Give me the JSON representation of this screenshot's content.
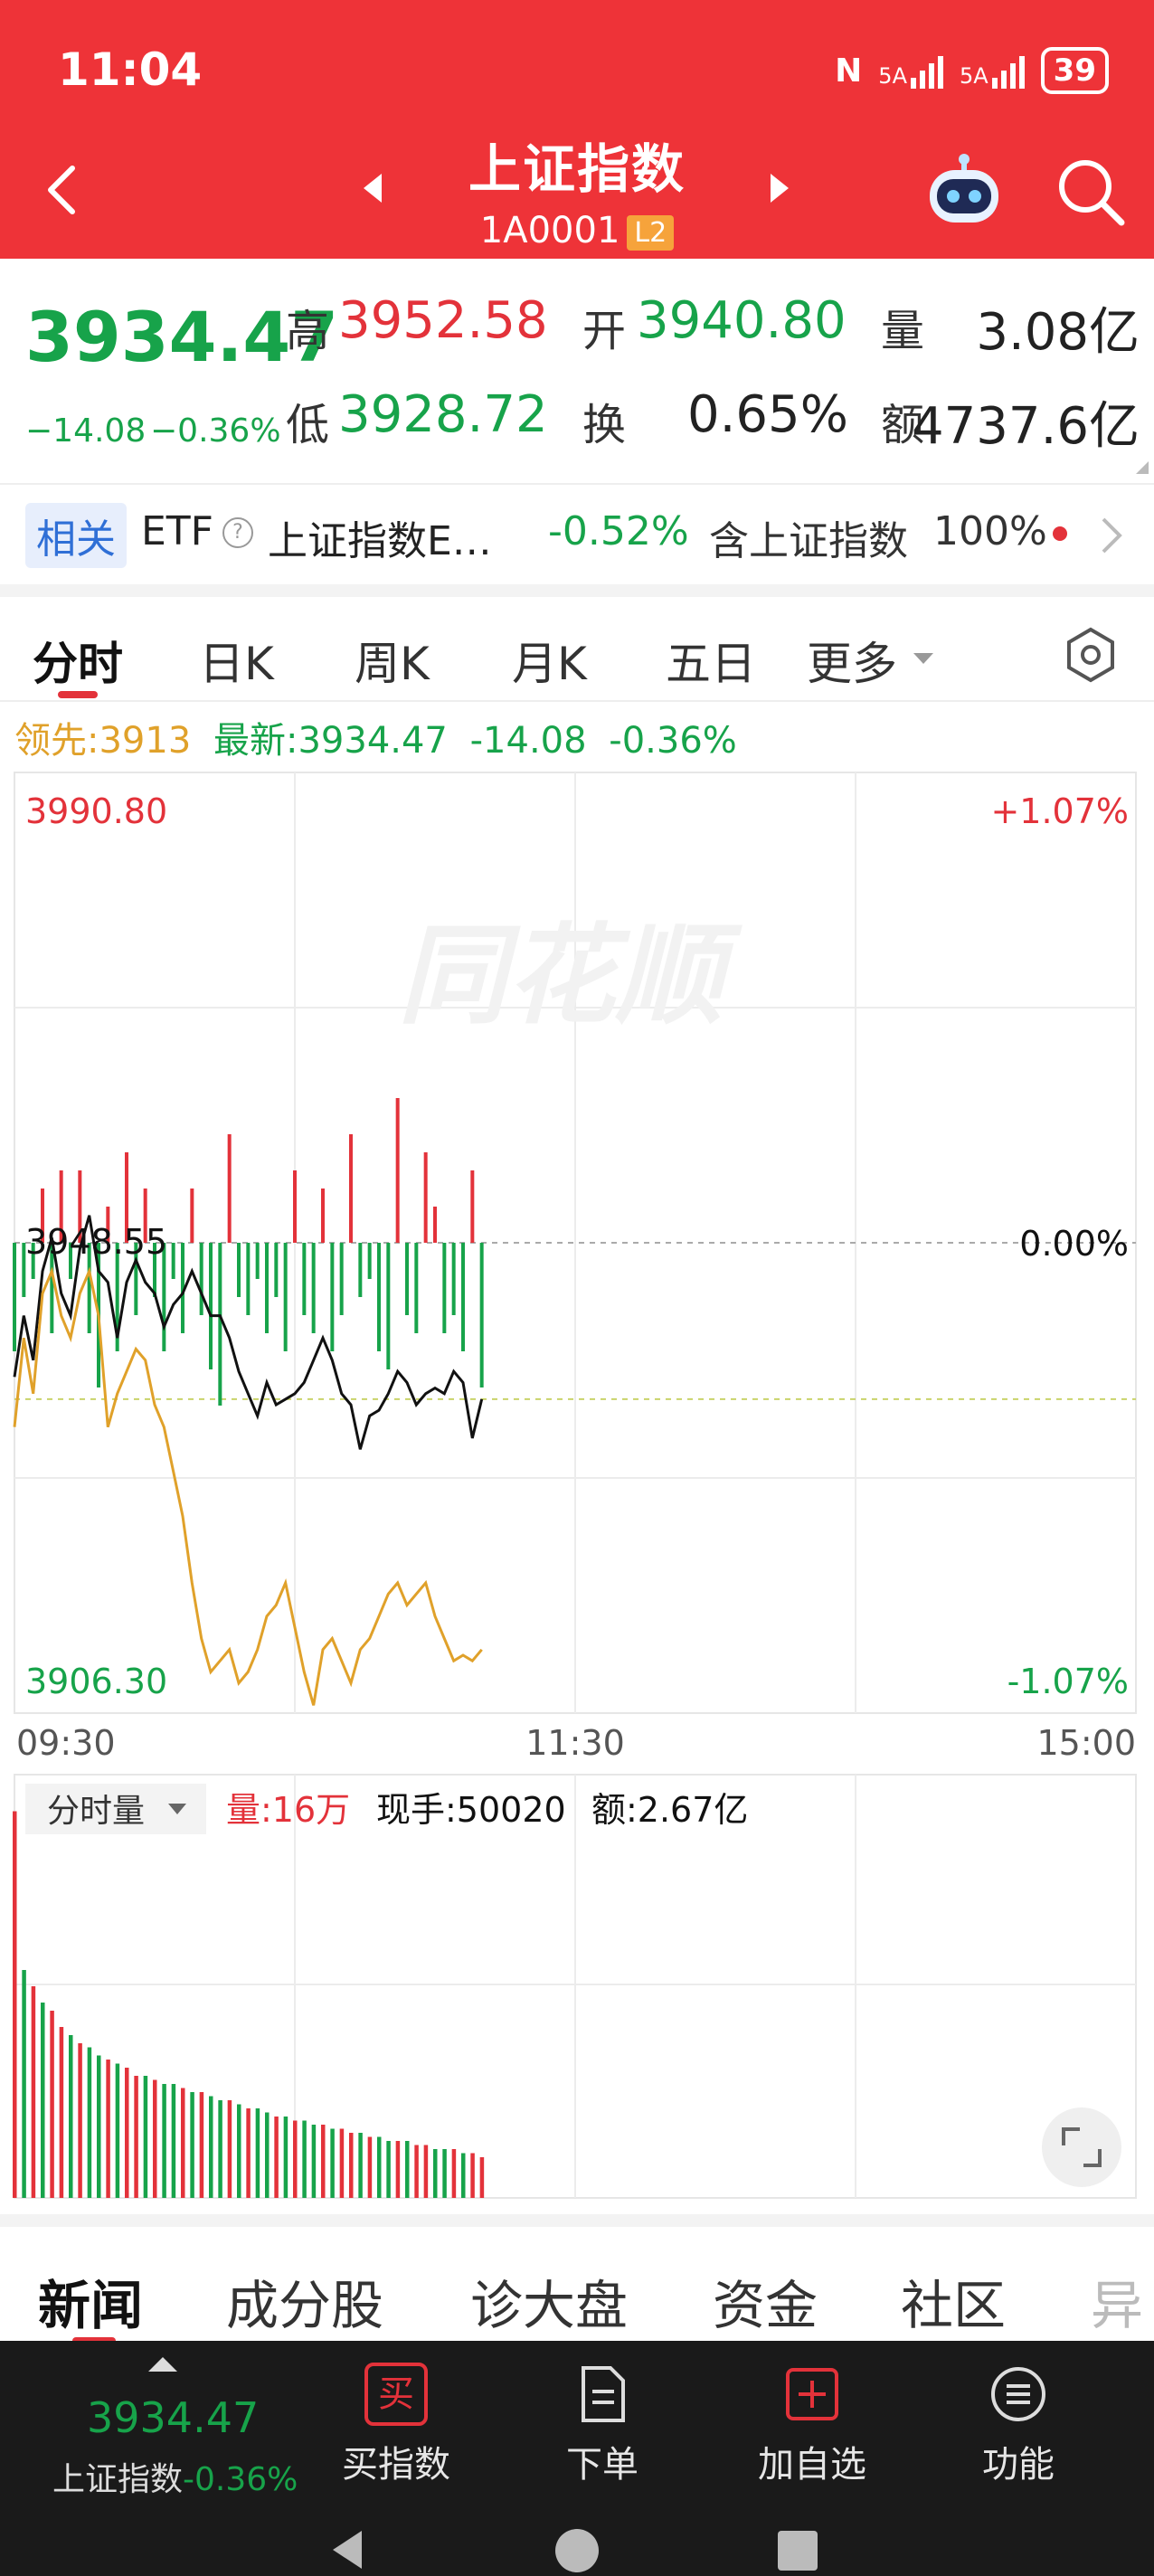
{
  "status_bar": {
    "time": "11:04",
    "net1": "5A",
    "net2": "5A",
    "battery": "39"
  },
  "header": {
    "title": "上证指数",
    "code": "1A0001",
    "level_badge": "L2"
  },
  "quote": {
    "price": "3934.47",
    "change": "−14.08",
    "change_pct": "−0.36%",
    "high_label": "高",
    "high": "3952.58",
    "open_label": "开",
    "open": "3940.80",
    "volume_label": "量",
    "volume": "3.08亿",
    "low_label": "低",
    "low": "3928.72",
    "turnover_label": "换",
    "turnover": "0.65%",
    "amount_label": "额",
    "amount": "4737.6亿"
  },
  "related": {
    "tag": "相关",
    "type": "ETF",
    "info": "?",
    "name": "上证指数E…",
    "change": "-0.52%",
    "contains_label": "含上证指数",
    "contains_pct": "100%"
  },
  "tabs": [
    "分时",
    "日K",
    "周K",
    "月K",
    "五日",
    "更多"
  ],
  "chart_info": {
    "lead_label": "领先:3913",
    "latest_label": "最新:3934.47",
    "latest_change": "-14.08",
    "latest_pct": "-0.36%"
  },
  "chart_data": {
    "type": "line",
    "y_top_label": "3990.80",
    "y_bottom_label": "3906.30",
    "pct_top_label": "+1.07%",
    "pct_mid_label": "0.00%",
    "pct_bottom_label": "-1.07%",
    "prev_close_label": "3948.55",
    "x_labels": [
      "09:30",
      "11:30",
      "15:00"
    ],
    "ylim": [
      3906.3,
      3990.8
    ],
    "prev_close": 3948.55,
    "total_minutes": 240,
    "series": [
      {
        "color": "#111111",
        "x": [
          0,
          2,
          4,
          6,
          8,
          10,
          12,
          14,
          16,
          18,
          20,
          22,
          24,
          26,
          28,
          30,
          32,
          34,
          36,
          38,
          40,
          42,
          44,
          46,
          48,
          50,
          52,
          54,
          56,
          58,
          60,
          62,
          64,
          66,
          68,
          70,
          72,
          74,
          76,
          78,
          80,
          82,
          84,
          86,
          88,
          90,
          92,
          94,
          96,
          98,
          100
        ],
        "values": [
          3936.5,
          3942,
          3938,
          3946,
          3949,
          3944,
          3942,
          3948,
          3951,
          3946,
          3945,
          3940,
          3945,
          3947,
          3945,
          3944,
          3941,
          3943,
          3944,
          3946,
          3944,
          3942,
          3942,
          3940,
          3937,
          3935,
          3933,
          3936,
          3934,
          3934.5,
          3935,
          3936,
          3938,
          3940,
          3938,
          3935,
          3934,
          3930,
          3933,
          3933.5,
          3935,
          3937,
          3936,
          3934,
          3935,
          3935.5,
          3935,
          3937,
          3936,
          3931,
          3934.5
        ]
      },
      {
        "color": "#e0a12a",
        "x": [
          0,
          2,
          4,
          6,
          8,
          10,
          12,
          14,
          16,
          18,
          20,
          22,
          24,
          26,
          28,
          30,
          32,
          34,
          36,
          38,
          40,
          42,
          44,
          46,
          48,
          50,
          52,
          54,
          56,
          58,
          60,
          62,
          64,
          66,
          68,
          70,
          72,
          74,
          76,
          78,
          80,
          82,
          84,
          86,
          88,
          90,
          92,
          94,
          96,
          98,
          100
        ],
        "values": [
          3932,
          3940,
          3935,
          3944,
          3946,
          3942,
          3940,
          3944,
          3946,
          3942,
          3932,
          3935,
          3937,
          3939,
          3938,
          3934,
          3932,
          3928,
          3924,
          3918,
          3913,
          3910,
          3911,
          3912,
          3909,
          3910,
          3912,
          3915,
          3916,
          3918,
          3914,
          3910,
          3907,
          3912,
          3913,
          3911,
          3909,
          3912,
          3913,
          3915,
          3917,
          3918,
          3916,
          3917,
          3918,
          3915,
          3913,
          3911,
          3911.5,
          3911,
          3912
        ]
      }
    ],
    "bars_top_values": [
      -6,
      -3,
      -2,
      3,
      -5,
      4,
      -2,
      4,
      -5,
      -8,
      2,
      -6,
      5,
      -4,
      3,
      -3,
      -6,
      -2,
      -5,
      3,
      -4,
      -7,
      -9,
      6,
      -3,
      -4,
      -2,
      -5,
      -3,
      -6,
      4,
      -4,
      -5,
      3,
      -6,
      -4,
      6,
      -3,
      -2,
      -6,
      -7,
      8,
      -4,
      -5,
      5,
      2,
      -5,
      -4,
      -6,
      4,
      -8
    ],
    "volume_label": "量:16万",
    "hand_label": "现手:50020",
    "amount_label": "额:2.67亿",
    "volume_selector": "分时量",
    "volume_values": [
      95,
      56,
      52,
      48,
      46,
      42,
      40,
      38,
      37,
      35,
      34,
      33,
      32,
      30,
      30,
      29,
      28,
      28,
      27,
      26,
      26,
      25,
      24,
      24,
      23,
      22,
      22,
      21,
      20,
      20,
      19,
      19,
      18,
      18,
      17,
      17,
      16,
      16,
      15,
      15,
      14,
      14,
      14,
      13,
      13,
      12,
      12,
      12,
      11,
      11,
      10
    ],
    "volume_colors": [
      "r",
      "g",
      "r",
      "g",
      "r",
      "r",
      "g",
      "r",
      "g",
      "g",
      "r",
      "g",
      "r",
      "r",
      "g",
      "r",
      "g",
      "g",
      "r",
      "g",
      "r",
      "g",
      "g",
      "r",
      "g",
      "r",
      "g",
      "g",
      "r",
      "g",
      "r",
      "g",
      "g",
      "r",
      "g",
      "r",
      "r",
      "g",
      "r",
      "g",
      "g",
      "r",
      "g",
      "r",
      "r",
      "g",
      "g",
      "r",
      "g",
      "r",
      "r"
    ]
  },
  "news_tabs": [
    "新闻",
    "成分股",
    "诊大盘",
    "资金",
    "社区",
    "异"
  ],
  "toolbar": {
    "index_price": "3934.47",
    "index_name": "上证指数",
    "index_pct": "-0.36%",
    "buy_icon_text": "买",
    "buy_label": "买指数",
    "order_label": "下单",
    "watch_label": "加自选",
    "func_label": "功能"
  },
  "colors": {
    "header_red": "#ee3338",
    "up_red": "#e3323a",
    "down_green": "#17a34a",
    "avg_yellow": "#e0a12a"
  }
}
